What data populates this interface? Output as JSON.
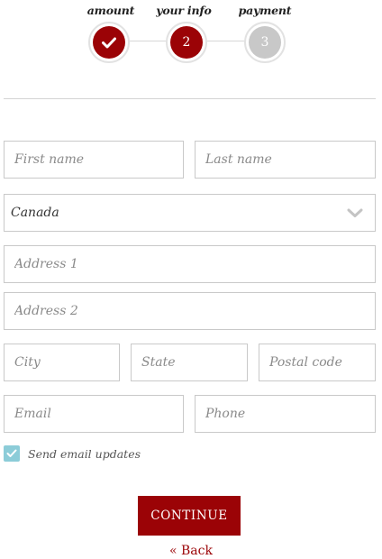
{
  "stepper": {
    "steps": [
      {
        "label": "amount",
        "number": "",
        "state": "done",
        "icon": "check-icon"
      },
      {
        "label": "your info",
        "number": "2",
        "state": "active"
      },
      {
        "label": "payment",
        "number": "3",
        "state": "inactive"
      }
    ],
    "colors": {
      "active": "#9b0306",
      "inactive": "#c8c8c8"
    }
  },
  "form": {
    "first_name": {
      "placeholder": "First name",
      "value": ""
    },
    "last_name": {
      "placeholder": "Last name",
      "value": ""
    },
    "country": {
      "selected": "Canada",
      "icon": "chevron-down-icon"
    },
    "address1": {
      "placeholder": "Address 1",
      "value": ""
    },
    "address2": {
      "placeholder": "Address 2",
      "value": ""
    },
    "city": {
      "placeholder": "City",
      "value": ""
    },
    "state": {
      "placeholder": "State",
      "value": ""
    },
    "postal_code": {
      "placeholder": "Postal code",
      "value": ""
    },
    "email": {
      "placeholder": "Email",
      "value": ""
    },
    "phone": {
      "placeholder": "Phone",
      "value": ""
    },
    "email_updates": {
      "label": "Send email updates",
      "checked": true,
      "color": "#8cccd8"
    }
  },
  "actions": {
    "continue_label": "CONTINUE",
    "back_label": "« Back",
    "accent": "#9b0306"
  }
}
